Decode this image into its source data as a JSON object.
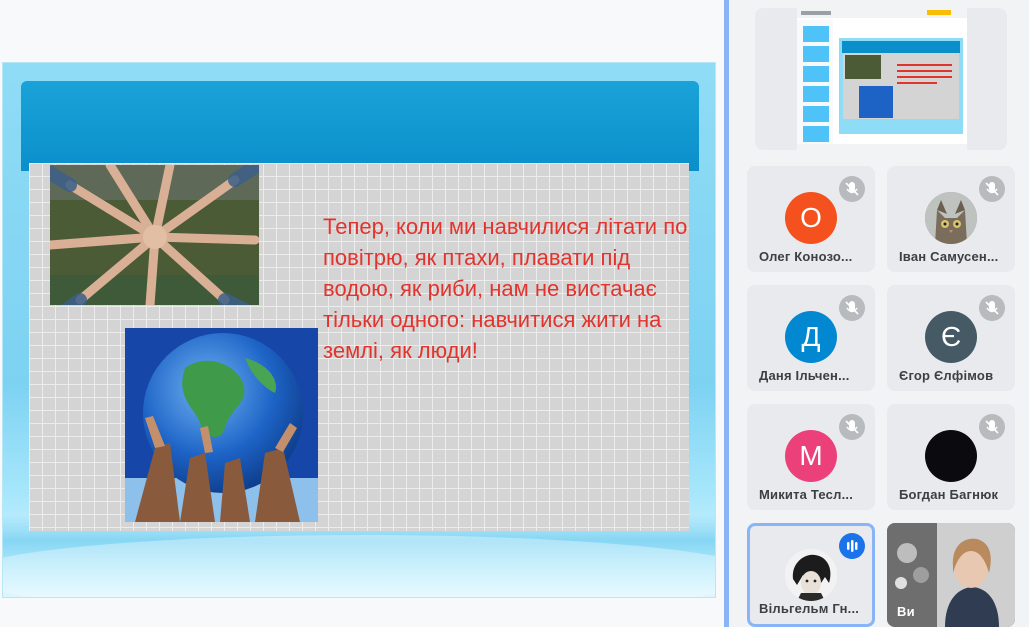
{
  "slide": {
    "text": "Тепер, коли ми навчилися літати по повітрю, як птахи, плавати під водою, як риби, нам не вистачає тільки одного: навчитися жити на землі, як люди!",
    "text_color": "#e2342d",
    "header_color": "#0b8fcb"
  },
  "participants": [
    {
      "name": "Олег Конозо...",
      "initial": "О",
      "avatar_color": "#f4511e",
      "muted": true
    },
    {
      "name": "Іван Самусен...",
      "initial": "",
      "avatar_type": "cat-photo",
      "muted": true
    },
    {
      "name": "Даня Ільчен...",
      "initial": "Д",
      "avatar_color": "#0288d1",
      "muted": true
    },
    {
      "name": "Єгор Єлфімов",
      "initial": "Є",
      "avatar_color": "#455a64",
      "muted": true
    },
    {
      "name": "Микита Тесл...",
      "initial": "М",
      "avatar_color": "#ec407a",
      "muted": true
    },
    {
      "name": "Богдан Багнюк",
      "initial": "",
      "avatar_color": "#0a0a0f",
      "muted": true
    },
    {
      "name": "Вільгельм Гн...",
      "initial": "",
      "avatar_type": "drawing-photo",
      "speaking": true
    },
    {
      "name": "Ви",
      "initial": "",
      "avatar_type": "camera-video"
    }
  ],
  "colors": {
    "accent": "#1a73e8",
    "active_border": "#8ab4f8",
    "tile_bg": "#e8eaed"
  }
}
